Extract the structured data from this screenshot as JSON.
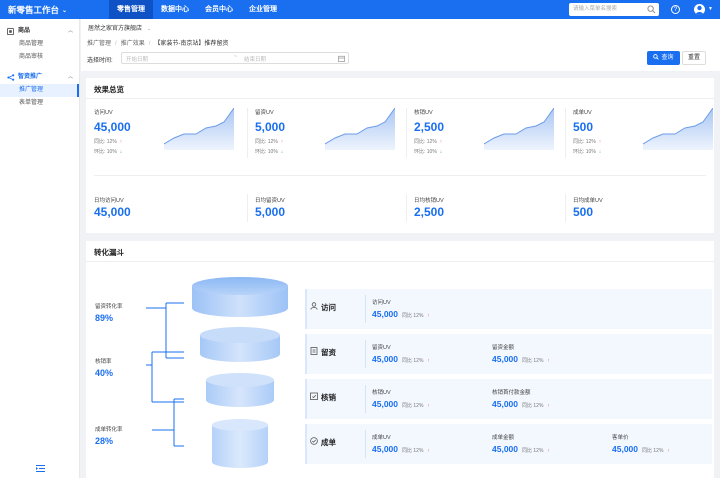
{
  "topbar": {
    "brand": "新零售工作台",
    "brand_caret": "⌄",
    "nav": [
      "零售管理",
      "数据中心",
      "会员中心",
      "企业管理"
    ],
    "search_placeholder": "请输入菜单名搜索",
    "help": "?"
  },
  "sidebar": {
    "groups": [
      {
        "label": "商品",
        "icon": "product-icon",
        "items": [
          "商品管理",
          "商品审核"
        ]
      },
      {
        "label": "智资推广",
        "icon": "promotion-icon",
        "items": [
          "推广管理",
          "表单管理"
        ]
      }
    ],
    "active_item": "推广管理"
  },
  "filter": {
    "store": "居然之家官方旗舰店",
    "store_caret": "⌄",
    "crumbs": [
      "推广管理",
      "推广效果",
      "【家装节-南京站】推荐留资"
    ],
    "date_label": "选择时间:",
    "start_placeholder": "开始日期",
    "end_placeholder": "结束日期",
    "tilde": "~",
    "query": "查询",
    "reset": "重置"
  },
  "overview": {
    "title": "效果总览",
    "metrics": [
      {
        "label": "访问UV",
        "value": "45,000",
        "yoy": "同比: 12%",
        "yoy_dir": "↑",
        "mom": "环比: 10%",
        "mom_dir": "↓"
      },
      {
        "label": "留资UV",
        "value": "5,000",
        "yoy": "同比: 12%",
        "yoy_dir": "↑",
        "mom": "环比: 10%",
        "mom_dir": "↓"
      },
      {
        "label": "核销UV",
        "value": "2,500",
        "yoy": "同比: 12%",
        "yoy_dir": "↑",
        "mom": "环比: 10%",
        "mom_dir": "↓"
      },
      {
        "label": "成单UV",
        "value": "500",
        "yoy": "同比: 12%",
        "yoy_dir": "↑",
        "mom": "环比: 10%",
        "mom_dir": "↓"
      }
    ],
    "averages": [
      {
        "label": "日均访问UV",
        "value": "45,000"
      },
      {
        "label": "日均留资UV",
        "value": "5,000"
      },
      {
        "label": "日均核销UV",
        "value": "2,500"
      },
      {
        "label": "日均成单UV",
        "value": "500"
      }
    ],
    "colors": {
      "accent": "#1a6ff0",
      "up": "#e64a3c",
      "down": "#1aad5e"
    }
  },
  "funnel": {
    "title": "转化漏斗",
    "rates": [
      {
        "label": "留资转化率",
        "value": "89%"
      },
      {
        "label": "核销率",
        "value": "40%"
      },
      {
        "label": "成单转化率",
        "value": "28%"
      }
    ],
    "stages": [
      {
        "name": "访问",
        "icon": "user-icon",
        "cells": [
          {
            "label": "访问UV",
            "value": "45,000",
            "pct": "同比 12%",
            "dir": "↑"
          }
        ]
      },
      {
        "name": "留资",
        "icon": "form-icon",
        "cells": [
          {
            "label": "留资UV",
            "value": "45,000",
            "pct": "同比 12%",
            "dir": "↑"
          },
          {
            "label": "留资金额",
            "value": "45,000",
            "pct": "同比 12%",
            "dir": "↑"
          }
        ]
      },
      {
        "name": "核销",
        "icon": "calendar-check-icon",
        "cells": [
          {
            "label": "核销UV",
            "value": "45,000",
            "pct": "同比 12%",
            "dir": "↑"
          },
          {
            "label": "核销首付款金额",
            "value": "45,000",
            "pct": "同比 12%",
            "dir": "↑"
          }
        ]
      },
      {
        "name": "成单",
        "icon": "check-circle-icon",
        "cells": [
          {
            "label": "成单UV",
            "value": "45,000",
            "pct": "同比 12%",
            "dir": "↑"
          },
          {
            "label": "成单金额",
            "value": "45,000",
            "pct": "同比 12%",
            "dir": "↑"
          },
          {
            "label": "客单价",
            "value": "45,000",
            "pct": "同比 12%",
            "dir": "↑"
          }
        ]
      }
    ]
  }
}
